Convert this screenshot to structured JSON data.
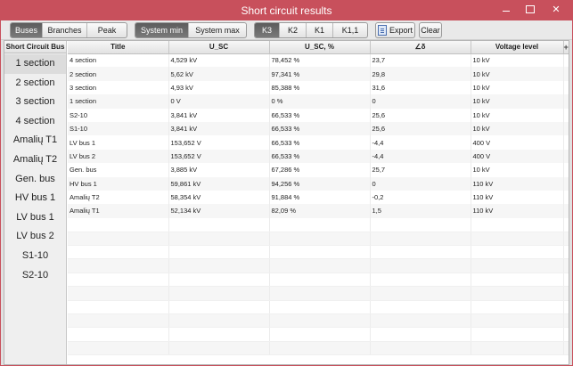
{
  "window": {
    "title": "Short circuit results"
  },
  "toolbar": {
    "view_tabs": [
      "Buses",
      "Branches",
      "Peak"
    ],
    "system_tabs": [
      "System min",
      "System max"
    ],
    "fault_tabs": [
      "K3",
      "K2",
      "K1",
      "K1,1"
    ],
    "export_label": "Export",
    "clear_label": "Clear"
  },
  "sidebar": {
    "header": "Short Circuit Bus",
    "items": [
      "1 section",
      "2 section",
      "3 section",
      "4 section",
      "Amalių T1",
      "Amalių T2",
      "Gen. bus",
      "HV bus 1",
      "LV bus 1",
      "LV bus 2",
      "S1-10",
      "S2-10"
    ]
  },
  "table": {
    "columns": [
      "Title",
      "U_SC",
      "U_SC, %",
      "∠δ",
      "Voltage level"
    ],
    "add_column_label": "+",
    "rows": [
      [
        "4 section",
        "4,529 kV",
        "78,452 %",
        "23,7",
        "10 kV"
      ],
      [
        "2 section",
        "5,62 kV",
        "97,341 %",
        "29,8",
        "10 kV"
      ],
      [
        "3 section",
        "4,93 kV",
        "85,388 %",
        "31,6",
        "10 kV"
      ],
      [
        "1 section",
        "0 V",
        "0 %",
        "0",
        "10 kV"
      ],
      [
        "S2-10",
        "3,841 kV",
        "66,533 %",
        "25,6",
        "10 kV"
      ],
      [
        "S1-10",
        "3,841 kV",
        "66,533 %",
        "25,6",
        "10 kV"
      ],
      [
        "LV bus 1",
        "153,652 V",
        "66,533 %",
        "-4,4",
        "400 V"
      ],
      [
        "LV bus 2",
        "153,652 V",
        "66,533 %",
        "-4,4",
        "400 V"
      ],
      [
        "Gen. bus",
        "3,885 kV",
        "67,286 %",
        "25,7",
        "10 kV"
      ],
      [
        "HV bus 1",
        "59,861 kV",
        "94,256 %",
        "0",
        "110 kV"
      ],
      [
        "Amalių T2",
        "58,354 kV",
        "91,884 %",
        "-0,2",
        "110 kV"
      ],
      [
        "Amalių T1",
        "52,134 kV",
        "82,09 %",
        "1,5",
        "110 kV"
      ]
    ]
  },
  "colors": {
    "titlebar": "#c8505c",
    "selected_toggle": "#666666"
  }
}
